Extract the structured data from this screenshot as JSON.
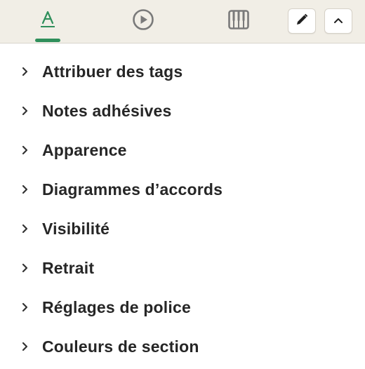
{
  "toolbar": {
    "tabs": [
      {
        "icon": "text-format-icon",
        "active": true
      },
      {
        "icon": "play-circle-icon",
        "active": false
      },
      {
        "icon": "piano-keys-icon",
        "active": false
      }
    ],
    "edit_icon": "pencil-icon",
    "collapse_icon": "chevron-up-icon",
    "accent_color": "#2f8f5b"
  },
  "panel": {
    "items": [
      {
        "label": "Attribuer des tags"
      },
      {
        "label": "Notes adhésives"
      },
      {
        "label": "Apparence"
      },
      {
        "label": "Diagrammes d’accords"
      },
      {
        "label": "Visibilité"
      },
      {
        "label": "Retrait"
      },
      {
        "label": "Réglages de police"
      },
      {
        "label": "Couleurs de section"
      }
    ]
  }
}
